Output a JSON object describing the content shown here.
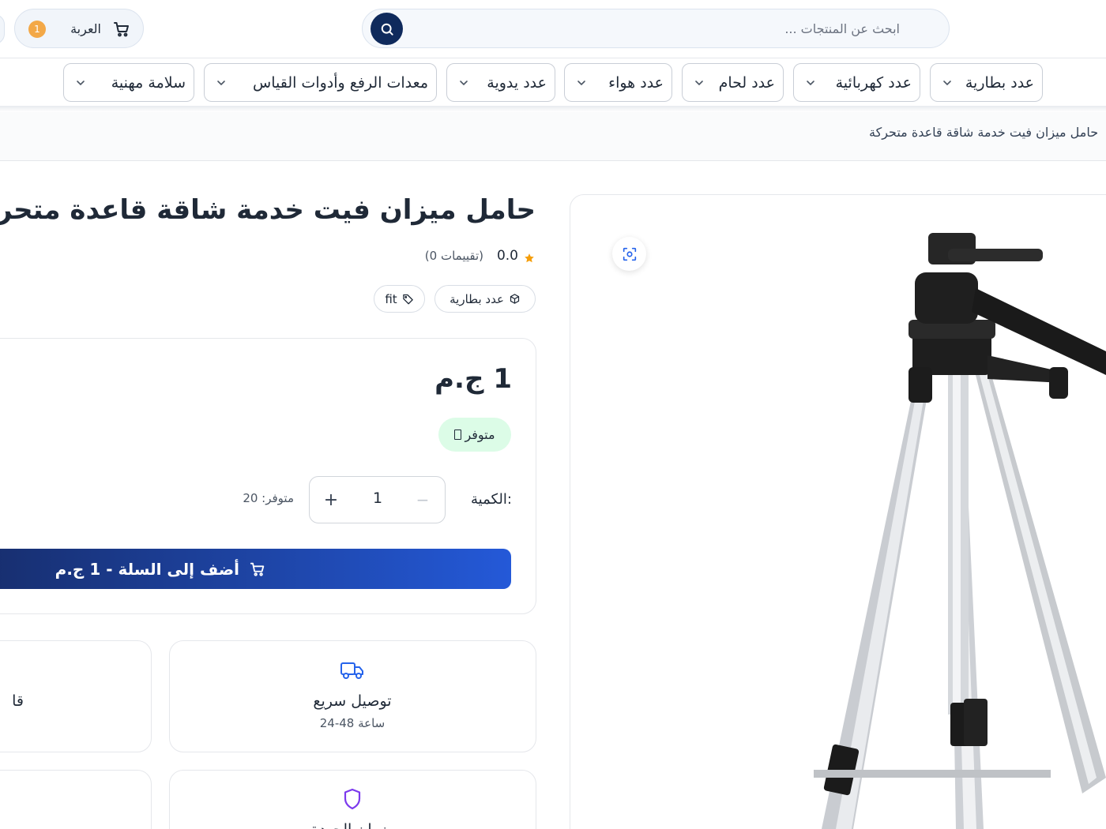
{
  "header": {
    "cart_label": "العربة",
    "cart_count": "1",
    "search_placeholder": "ابحث عن المنتجات ..."
  },
  "categories": [
    {
      "label": "عدد بطارية"
    },
    {
      "label": "عدد كهربائية"
    },
    {
      "label": "عدد لحام"
    },
    {
      "label": "عدد هواء"
    },
    {
      "label": "عدد يدوية"
    },
    {
      "label": "معدات الرفع وأدوات القياس"
    },
    {
      "label": "سلامة مهنية"
    }
  ],
  "breadcrumb": {
    "current": "حامل ميزان فيت خدمة شاقة قاعدة متحركة"
  },
  "product": {
    "title": "حامل ميزان فيت خدمة شاقة قاعدة متحركة",
    "rating": "0.0",
    "rating_count": "(0 تقييمات)",
    "category_chip": "عدد بطارية",
    "brand_chip": "fit",
    "price": "1 ج.م",
    "stock_status": "متوفر",
    "quantity_label": "الكمية:",
    "quantity": "1",
    "available_text": "متوفر: 20",
    "add_to_cart": "أضف إلى السلة - 1 ج.م"
  },
  "features": {
    "delivery_title": "توصيل سريع",
    "delivery_sub": "24-48 ساعة",
    "second_title": "قا",
    "warranty_title": "ضمان الجودة"
  },
  "colors": {
    "primary_dark": "#172e6e",
    "primary": "#2459d8",
    "search_button": "#0f2a5c",
    "badge": "#f3a847",
    "stock_bg": "#dcfce7",
    "feature_icon_blue": "#2563eb",
    "feature_icon_purple": "#7c3aed"
  },
  "icons": [
    "cart-icon",
    "search-icon",
    "chevron-down-icon",
    "zoom-icon",
    "star-icon",
    "box-icon",
    "tag-icon",
    "truck-icon",
    "shield-icon"
  ]
}
